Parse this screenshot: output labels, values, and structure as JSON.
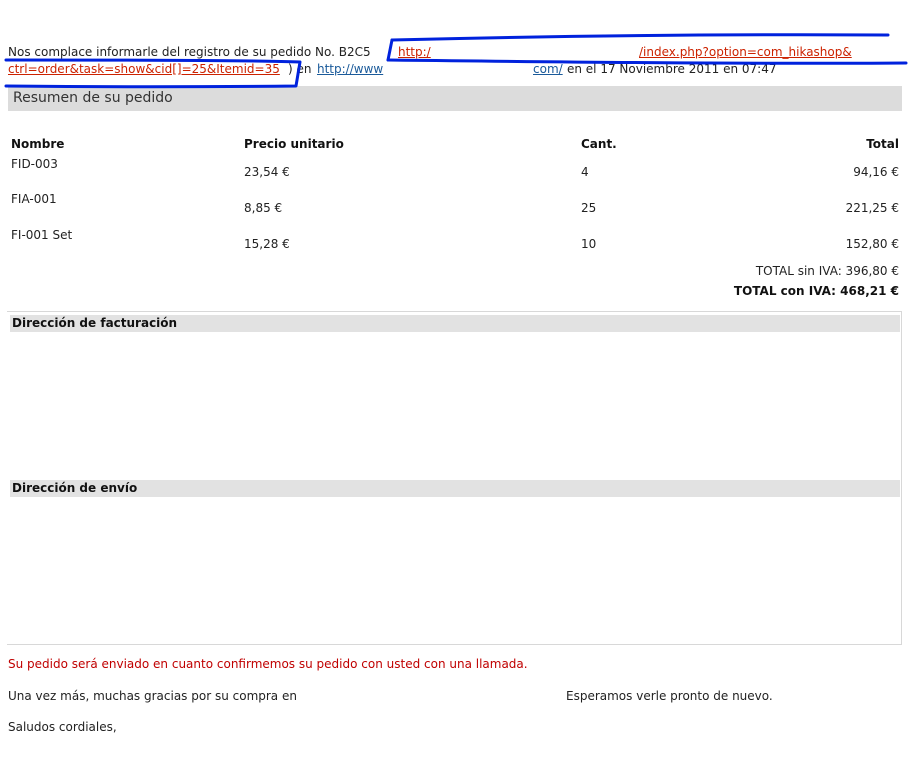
{
  "intro": {
    "text_before": "Nos complace informarle del registro de su pedido No. B2C5",
    "order_link_start": "http:/",
    "order_link_path": "/index.php?option=com_hikashop&",
    "order_link_cont": "ctrl=order&task=show&cid[]=25&Itemid=35",
    "paren_close_en": ") en",
    "site_link_start": "http://www",
    "site_link_end": "com/",
    "date_text": "en el 17 Noviembre 2011 en 07:47"
  },
  "summary": {
    "title": "Resumen de su pedido",
    "headers": {
      "name": "Nombre",
      "unit_price": "Precio unitario",
      "qty": "Cant.",
      "total": "Total"
    },
    "rows": [
      {
        "name": "FID-003",
        "unit_price": "23,54 €",
        "qty": "4",
        "total": "94,16 €"
      },
      {
        "name": "FIA-001",
        "unit_price": "8,85 €",
        "qty": "25",
        "total": "221,25 €"
      },
      {
        "name": "FI-001 Set",
        "unit_price": "15,28 €",
        "qty": "10",
        "total": "152,80 €"
      }
    ],
    "total_without_vat": "TOTAL sin IVA: 396,80 €",
    "total_with_vat": "TOTAL con IVA: 468,21 €"
  },
  "addresses": {
    "billing_title": "Dirección de facturación",
    "shipping_title": "Dirección de envío"
  },
  "footer": {
    "confirm_note": "Su pedido será enviado en cuanto confirmemos su pedido con usted con una llamada.",
    "thanks": "Una vez más, muchas gracias por su compra en",
    "hope": "Esperamos verle pronto de nuevo.",
    "regards": "Saludos cordiales,"
  },
  "colors": {
    "link_red": "#cc2200",
    "link_blue": "#1a5a9a",
    "note_red": "#c00000",
    "redaction_marker": "#0022dd",
    "section_bar": "#dcdcdc"
  }
}
